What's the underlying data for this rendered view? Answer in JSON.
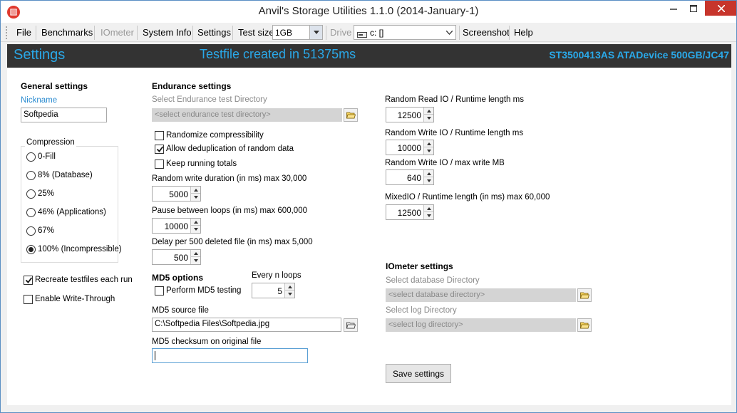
{
  "window": {
    "title": "Anvil's Storage Utilities 1.1.0 (2014-January-1)"
  },
  "menu": {
    "file": "File",
    "benchmarks": "Benchmarks",
    "iometer": "IOmeter",
    "system_info": "System Info",
    "settings": "Settings",
    "test_size_label": "Test size",
    "test_size_value": "1GB",
    "drive_label": "Drive",
    "drive_value": "c: []",
    "screenshot": "Screenshot",
    "help": "Help"
  },
  "header": {
    "title": "Settings",
    "status": "Testfile created in 51375ms",
    "device": "ST3500413AS ATADevice 500GB/JC47"
  },
  "general": {
    "heading": "General settings",
    "nickname_label": "Nickname",
    "nickname_value": "Softpedia",
    "compression_label": "Compression",
    "compression_options": [
      "0-Fill",
      "8% (Database)",
      "25%",
      "46% (Applications)",
      "67%",
      "100% (Incompressible)"
    ],
    "compression_selected": 5,
    "recreate_label": "Recreate testfiles each run",
    "recreate_checked": true,
    "write_through_label": "Enable Write-Through",
    "write_through_checked": false
  },
  "endurance": {
    "heading": "Endurance settings",
    "dir_label": "Select Endurance test Directory",
    "dir_placeholder": "<select endurance test directory>",
    "randomize_label": "Randomize compressibility",
    "randomize_checked": false,
    "dedup_label": "Allow deduplication of random data",
    "dedup_checked": true,
    "running_totals_label": "Keep running totals",
    "running_totals_checked": false,
    "random_write_label": "Random write duration (in ms) max 30,000",
    "random_write_value": "5000",
    "pause_label": "Pause between loops (in ms) max 600,000",
    "pause_value": "10000",
    "delay_label": "Delay per 500 deleted file (in ms) max 5,000",
    "delay_value": "500"
  },
  "md5": {
    "heading": "MD5 options",
    "perform_label": "Perform MD5 testing",
    "perform_checked": false,
    "every_n_label": "Every n loops",
    "every_n_value": "5",
    "source_label": "MD5 source file",
    "source_value": "C:\\Softpedia Files\\Softpedia.jpg",
    "checksum_label": "MD5 checksum on original file",
    "checksum_value": ""
  },
  "runtime": {
    "read_io_label": "Random Read IO / Runtime length ms",
    "read_io_value": "12500",
    "write_io_label": "Random Write IO / Runtime length ms",
    "write_io_value": "10000",
    "write_max_label": "Random Write IO / max write MB",
    "write_max_value": "640",
    "mixed_label": "MixedIO / Runtime length (in ms) max 60,000",
    "mixed_value": "12500"
  },
  "iometer": {
    "heading": "IOmeter settings",
    "db_label": "Select database Directory",
    "db_placeholder": "<select database directory>",
    "log_label": "Select log Directory",
    "log_placeholder": "<select log directory>"
  },
  "actions": {
    "save": "Save settings"
  },
  "colors": {
    "accent_blue": "#2aa8e8",
    "header_bg": "#333333",
    "close_red": "#c7352c"
  }
}
